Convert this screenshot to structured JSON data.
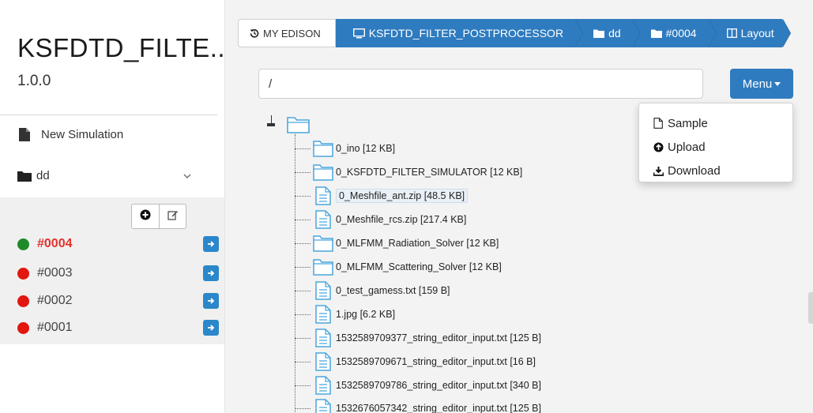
{
  "sidebar": {
    "app_title": "KSFDTD_FILTE..",
    "app_version": "1.0.0",
    "new_simulation_label": "New Simulation",
    "folder_label": "dd",
    "jobs": [
      {
        "label": "#0004",
        "status_color": "#1e8a2c",
        "active": true
      },
      {
        "label": "#0003",
        "status_color": "#e2170f",
        "active": false
      },
      {
        "label": "#0002",
        "status_color": "#e2170f",
        "active": false
      },
      {
        "label": "#0001",
        "status_color": "#e2170f",
        "active": false
      }
    ]
  },
  "breadcrumb": {
    "home_label": "MY EDISON",
    "app_label": "KSFDTD_FILTER_POSTPROCESSOR",
    "folder_label": "dd",
    "job_label": "#0004",
    "layout_label": "Layout"
  },
  "toolbar": {
    "path_value": "/",
    "menu_label": "Menu"
  },
  "menu": {
    "items": [
      {
        "label": "Sample",
        "icon": "file-icon"
      },
      {
        "label": "Upload",
        "icon": "upload-icon"
      },
      {
        "label": "Download",
        "icon": "download-icon"
      }
    ]
  },
  "tree": {
    "items": [
      {
        "label": "0_ino [12 KB]",
        "type": "folder"
      },
      {
        "label": "0_KSFDTD_FILTER_SIMULATOR [12 KB]",
        "type": "folder"
      },
      {
        "label": "0_Meshfile_ant.zip [48.5 KB]",
        "type": "file",
        "selected": true
      },
      {
        "label": "0_Meshfile_rcs.zip [217.4 KB]",
        "type": "file"
      },
      {
        "label": "0_MLFMM_Radiation_Solver [12 KB]",
        "type": "folder"
      },
      {
        "label": "0_MLFMM_Scattering_Solver [12 KB]",
        "type": "folder"
      },
      {
        "label": "0_test_gamess.txt [159 B]",
        "type": "file"
      },
      {
        "label": "1.jpg [6.2 KB]",
        "type": "file"
      },
      {
        "label": "1532589709377_string_editor_input.txt [125 B]",
        "type": "file"
      },
      {
        "label": "1532589709671_string_editor_input.txt [16 B]",
        "type": "file"
      },
      {
        "label": "1532589709786_string_editor_input.txt [340 B]",
        "type": "file"
      },
      {
        "label": "1532676057342_string_editor_input.txt [125 B]",
        "type": "file"
      }
    ]
  },
  "colors": {
    "accent": "#2f7bbf",
    "running": "#1e8a2c",
    "stopped": "#e2170f",
    "active_job_text": "#e2322c"
  }
}
